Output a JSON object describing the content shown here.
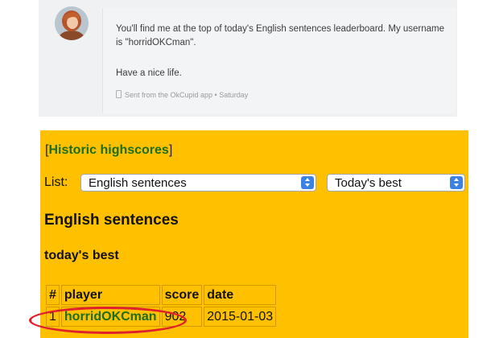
{
  "message": {
    "avatar": "avatar-photo",
    "paragraph1": "You'll find me at the top of today's English sentences leaderboard. My username is \"horridOKCman\".",
    "paragraph2": "Have a nice life.",
    "meta": "Sent from the OkCupid app • Saturday",
    "meta_icon": "phone-icon"
  },
  "highscores": {
    "title_open": "[",
    "title_link": "Historic highscores",
    "title_close": "]",
    "list_label": "List:",
    "list_select": {
      "selected": "English sentences"
    },
    "period_select": {
      "selected": "Today's best"
    },
    "category_heading": "English sentences",
    "period_heading": "today's best",
    "table": {
      "columns": [
        "#",
        "player",
        "score",
        "date"
      ],
      "rows": [
        {
          "rank": "1",
          "player": "horridOKCman",
          "score": "902",
          "date": "2015-01-03"
        }
      ]
    },
    "highlight_color": "#e0202a",
    "panel_color": "#ffc000",
    "link_color": "#1c6e1c"
  }
}
